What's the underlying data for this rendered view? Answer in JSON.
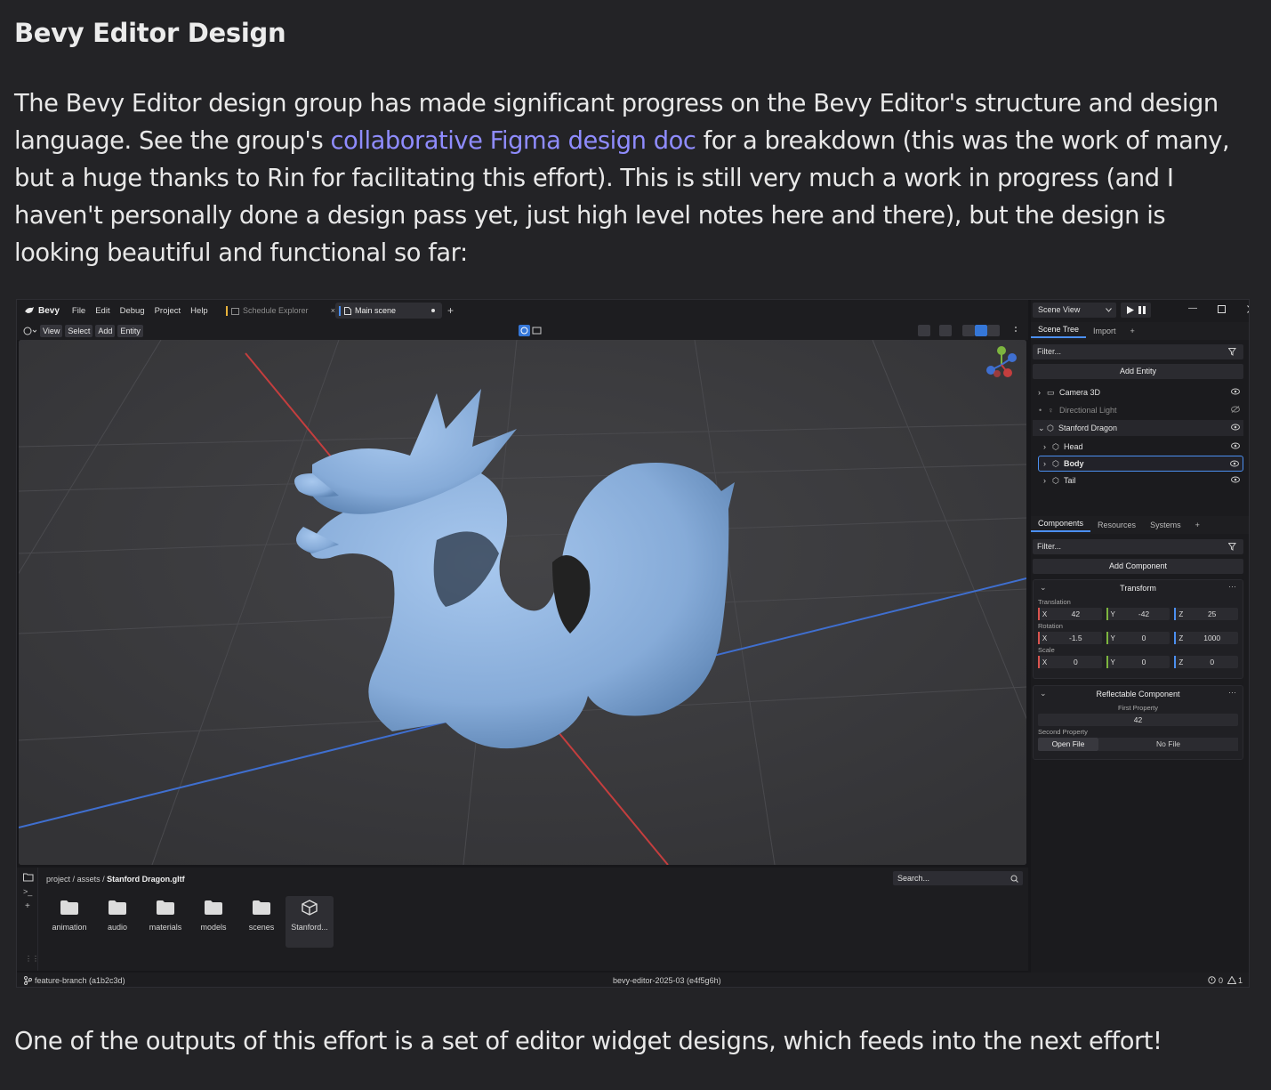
{
  "article": {
    "heading": "Bevy Editor Design",
    "para_before_link": "The Bevy Editor design group has made significant progress on the Bevy Editor's structure and design language. See the group's ",
    "link_text": "collaborative Figma design doc",
    "para_after_link": " for a breakdown (this was the work of many, but a huge thanks to Rin for facilitating this effort). This is still very much a work in progress (and I haven't personally done a design pass yet, just high level notes here and there), but the design is looking beautiful and functional so far:",
    "closing": "One of the outputs of this effort is a set of editor widget designs, which feeds into the next effort!"
  },
  "editor": {
    "app_name": "Bevy",
    "menu": [
      "File",
      "Edit",
      "Debug",
      "Project",
      "Help"
    ],
    "tabs": [
      {
        "label": "Schedule Explorer",
        "close": "×"
      },
      {
        "label": "Main scene"
      }
    ],
    "tab_add": "+",
    "toolbar": [
      "View",
      "Select",
      "Add",
      "Entity"
    ],
    "scene_view_select": "Scene View",
    "scene_tree_tabs": [
      "Scene Tree",
      "Import"
    ],
    "tab_plus": "+",
    "filter_placeholder": "Filter...",
    "add_entity": "Add Entity",
    "tree": [
      {
        "label": "Camera 3D",
        "icon": "camera-icon",
        "visible": true
      },
      {
        "label": "Directional Light",
        "icon": "bulb-icon",
        "visible": false
      },
      {
        "label": "Stanford Dragon",
        "icon": "cube-icon",
        "visible": true
      },
      {
        "label": "Head",
        "icon": "cube-icon",
        "visible": true
      },
      {
        "label": "Body",
        "icon": "cube-icon",
        "visible": true
      },
      {
        "label": "Tail",
        "icon": "cube-icon",
        "visible": true
      }
    ],
    "inspector_tabs": [
      "Components",
      "Resources",
      "Systems"
    ],
    "add_component": "Add Component",
    "transform": {
      "title": "Transform",
      "translation_label": "Translation",
      "rotation_label": "Rotation",
      "scale_label": "Scale",
      "axes": [
        "X",
        "Y",
        "Z"
      ],
      "translation": [
        "42",
        "-42",
        "25"
      ],
      "rotation": [
        "-1.5",
        "0",
        "1000"
      ],
      "scale": [
        "0",
        "0",
        "0"
      ]
    },
    "reflectable": {
      "title": "Reflectable Component",
      "first_label": "First Property",
      "first_value": "42",
      "second_label": "Second Property",
      "open_file": "Open File",
      "no_file": "No File"
    },
    "assets": {
      "crumb_project": "project",
      "crumb_assets": "assets",
      "crumb_file": "Stanford Dragon.gltf",
      "sep": "/",
      "search": "Search...",
      "items": [
        "animation",
        "audio",
        "materials",
        "models",
        "scenes",
        "Stanford..."
      ]
    },
    "status": {
      "branch": "feature-branch (a1b2c3d)",
      "version": "bevy-editor-2025-03 (e4f5g6h)",
      "errors": "0",
      "warnings": "1"
    },
    "colors": {
      "accent": "#4b8ff0",
      "x_axis": "#d9544f",
      "y_axis": "#7db53f",
      "z_axis": "#4b8ff0",
      "dragon": "#8fb4e0"
    }
  }
}
